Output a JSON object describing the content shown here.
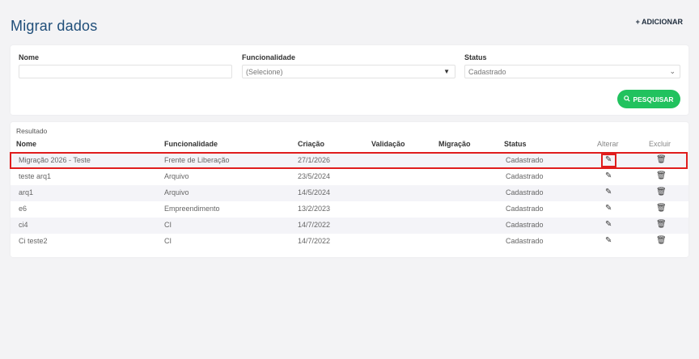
{
  "page": {
    "title": "Migrar dados",
    "add_label": "+ ADICIONAR"
  },
  "filters": {
    "nome_label": "Nome",
    "nome_value": "",
    "funcionalidade_label": "Funcionalidade",
    "funcionalidade_value": "(Selecione)",
    "status_label": "Status",
    "status_value": "Cadastrado",
    "search_label": "PESQUISAR"
  },
  "results": {
    "label": "Resultado",
    "columns": [
      "Nome",
      "Funcionalidade",
      "Criação",
      "Validação",
      "Migração",
      "Status",
      "Alterar",
      "Excluir"
    ],
    "rows": [
      {
        "nome": "Migração 2026 - Teste",
        "funcionalidade": "Frente de Liberação",
        "criacao": "27/1/2026",
        "validacao": "",
        "migracao": "",
        "status": "Cadastrado"
      },
      {
        "nome": "teste arq1",
        "funcionalidade": "Arquivo",
        "criacao": "23/5/2024",
        "validacao": "",
        "migracao": "",
        "status": "Cadastrado"
      },
      {
        "nome": "arq1",
        "funcionalidade": "Arquivo",
        "criacao": "14/5/2024",
        "validacao": "",
        "migracao": "",
        "status": "Cadastrado"
      },
      {
        "nome": "e6",
        "funcionalidade": "Empreendimento",
        "criacao": "13/2/2023",
        "validacao": "",
        "migracao": "",
        "status": "Cadastrado"
      },
      {
        "nome": "ci4",
        "funcionalidade": "CI",
        "criacao": "14/7/2022",
        "validacao": "",
        "migracao": "",
        "status": "Cadastrado"
      },
      {
        "nome": "Ci teste2",
        "funcionalidade": "CI",
        "criacao": "14/7/2022",
        "validacao": "",
        "migracao": "",
        "status": "Cadastrado"
      }
    ]
  },
  "icons": {
    "edit": "edit-icon",
    "delete": "trash-icon",
    "search": "search-icon",
    "dropdown": "chevron-down-icon"
  },
  "colors": {
    "title": "#1f4e79",
    "accent": "#21c25e",
    "highlight": "#e01d1d"
  }
}
